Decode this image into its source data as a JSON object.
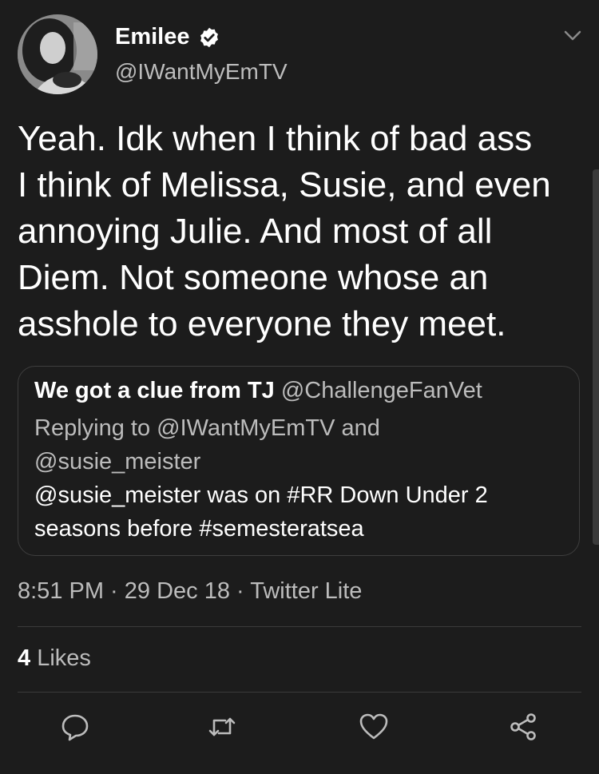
{
  "author": {
    "display_name": "Emilee",
    "handle": "@IWantMyEmTV",
    "verified": true
  },
  "tweet_text": "Yeah. Idk when I think of bad ass\nI think of Melissa, Susie, and even\nannoying Julie. And most of all\nDiem. Not someone whose an\nasshole to everyone they meet.",
  "quoted_tweet": {
    "display_name": "We got a clue from TJ",
    "handle": "@ChallengeFanVet",
    "replying_to": "Replying to @IWantMyEmTV and\n@susie_meister",
    "text": "@susie_meister was on #RR Down Under 2\nseasons before #semesteratsea"
  },
  "meta": {
    "timestamp": "8:51 PM · 29 Dec 18 · Twitter Lite"
  },
  "stats": {
    "likes_count": "4",
    "likes_label": "Likes"
  },
  "actions": [
    {
      "name": "reply",
      "icon": "speech-bubble-icon"
    },
    {
      "name": "retweet",
      "icon": "retweet-icon"
    },
    {
      "name": "like",
      "icon": "heart-icon"
    },
    {
      "name": "share",
      "icon": "share-icon"
    }
  ],
  "colors": {
    "background": "#1c1c1c",
    "primary_text": "#ffffff",
    "secondary_text": "#bcbcbc",
    "border": "#3e3e3e"
  }
}
